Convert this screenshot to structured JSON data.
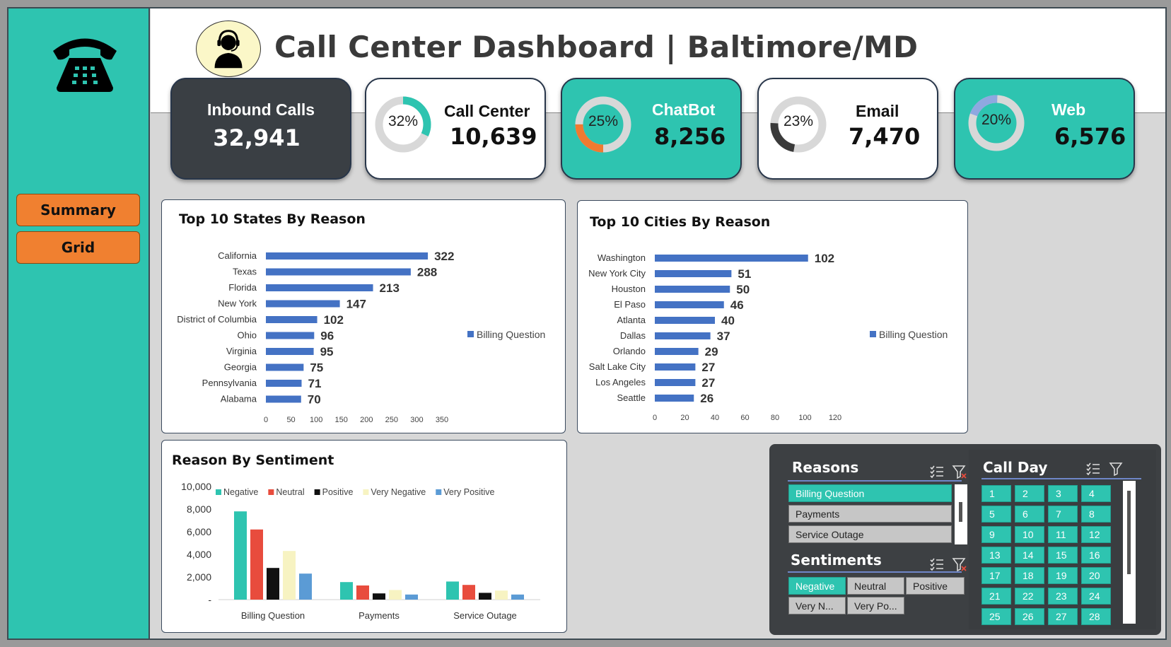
{
  "header": {
    "title": "Call Center Dashboard | Baltimore/MD"
  },
  "nav": {
    "summary": "Summary",
    "grid": "Grid"
  },
  "kpis": [
    {
      "label": "Inbound Calls",
      "value": "32,941"
    },
    {
      "label": "Call Center",
      "value": "10,639",
      "pct": "32%",
      "pct_value": 0.32,
      "ring_color": "#2ec4b0"
    },
    {
      "label": "ChatBot",
      "value": "8,256",
      "pct": "25%",
      "pct_value": 0.25,
      "ring_color": "#f07a30"
    },
    {
      "label": "Email",
      "value": "7,470",
      "pct": "23%",
      "pct_value": 0.23,
      "ring_color": "#3a3a3a"
    },
    {
      "label": "Web",
      "value": "6,576",
      "pct": "20%",
      "pct_value": 0.2,
      "ring_color": "#8ea8e0"
    }
  ],
  "colors": {
    "teal": "#2ec4b0",
    "orange": "#f08030",
    "bar_blue": "#4472c4",
    "dark": "#3a3f44"
  },
  "chart_data": [
    {
      "type": "bar",
      "orientation": "horizontal",
      "title": "Top 10 States By Reason",
      "categories": [
        "California",
        "Texas",
        "Florida",
        "New York",
        "District of Columbia",
        "Ohio",
        "Virginia",
        "Georgia",
        "Pennsylvania",
        "Alabama"
      ],
      "series": [
        {
          "name": "Billing Question",
          "values": [
            322,
            288,
            213,
            147,
            102,
            96,
            95,
            75,
            71,
            70
          ]
        }
      ],
      "xticks": [
        "0",
        "50",
        "100",
        "150",
        "200",
        "250",
        "300",
        "350"
      ],
      "xlim": [
        0,
        350
      ],
      "legend": "right"
    },
    {
      "type": "bar",
      "orientation": "horizontal",
      "title": "Top 10 Cities By Reason",
      "categories": [
        "Washington",
        "New York City",
        "Houston",
        "El Paso",
        "Atlanta",
        "Dallas",
        "Orlando",
        "Salt Lake City",
        "Los Angeles",
        "Seattle"
      ],
      "series": [
        {
          "name": "Billing Question",
          "values": [
            102,
            51,
            50,
            46,
            40,
            37,
            29,
            27,
            27,
            26
          ]
        }
      ],
      "xticks": [
        "0",
        "20",
        "40",
        "60",
        "80",
        "100",
        "120"
      ],
      "xlim": [
        0,
        120
      ],
      "legend": "right"
    },
    {
      "type": "bar",
      "title": "Reason By Sentiment",
      "categories": [
        "Billing Question",
        "Payments",
        "Service Outage"
      ],
      "series": [
        {
          "name": "Negative",
          "color": "#2ec4b0",
          "values": [
            7800,
            1550,
            1600
          ]
        },
        {
          "name": "Neutral",
          "color": "#e84c3d",
          "values": [
            6200,
            1250,
            1300
          ]
        },
        {
          "name": "Positive",
          "color": "#111111",
          "values": [
            2800,
            550,
            600
          ]
        },
        {
          "name": "Very Negative",
          "color": "#f7f3c2",
          "values": [
            4300,
            850,
            800
          ]
        },
        {
          "name": "Very Positive",
          "color": "#5b9bd5",
          "values": [
            2300,
            450,
            450
          ]
        }
      ],
      "yticks": [
        "-",
        "2,000",
        "4,000",
        "6,000",
        "8,000",
        "10,000"
      ],
      "ylim": [
        0,
        10000
      ],
      "legend": "top"
    }
  ],
  "slicers": {
    "reasons": {
      "title": "Reasons",
      "items": [
        "Billing Question",
        "Payments",
        "Service Outage"
      ],
      "selected": "Billing Question"
    },
    "sentiments": {
      "title": "Sentiments",
      "items": [
        "Negative",
        "Neutral",
        "Positive",
        "Very N...",
        "Very Po..."
      ],
      "selected": "Negative"
    },
    "call_day": {
      "title": "Call Day",
      "days": [
        "1",
        "2",
        "3",
        "4",
        "5",
        "6",
        "7",
        "8",
        "9",
        "10",
        "11",
        "12",
        "13",
        "14",
        "15",
        "16",
        "17",
        "18",
        "19",
        "20",
        "21",
        "22",
        "23",
        "24",
        "25",
        "26",
        "27",
        "28"
      ]
    }
  }
}
